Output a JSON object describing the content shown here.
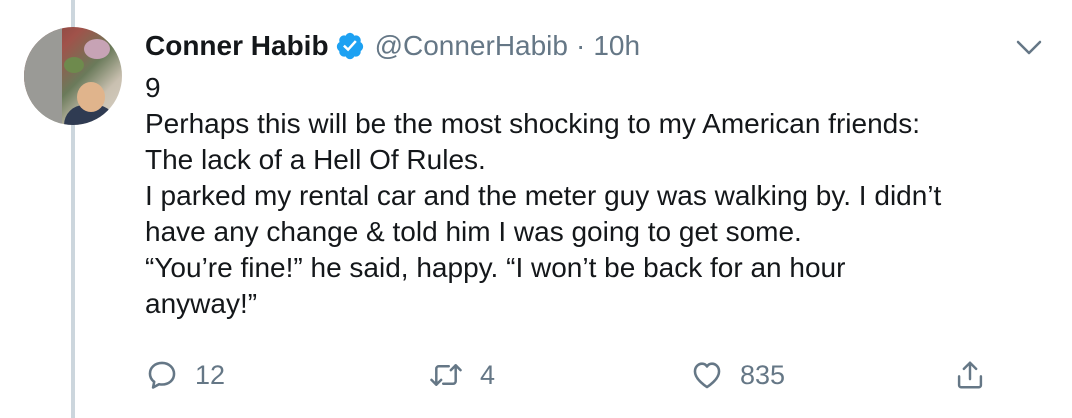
{
  "author": {
    "name": "Conner Habib",
    "handle": "@ConnerHabib",
    "separator": "·",
    "time": "10h",
    "verified": true
  },
  "tweet": {
    "lines": [
      "9",
      "Perhaps this will be the most shocking to my American friends:",
      "The lack of a Hell Of Rules.",
      "I parked my rental car and the meter guy was walking by. I didn’t",
      "have any change & told him I was going to get some.",
      "“You’re fine!” he said, happy. “I won’t be back for an hour",
      "anyway!”"
    ]
  },
  "actions": {
    "reply_count": "12",
    "retweet_count": "4",
    "like_count": "835"
  },
  "colors": {
    "text": "#14171a",
    "secondary": "#657786",
    "verified": "#1da1f2",
    "thread_line": "#ccd6dd"
  }
}
